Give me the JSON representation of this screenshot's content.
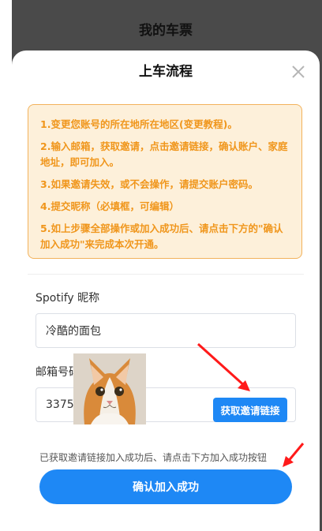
{
  "header": {
    "title": "我的车票"
  },
  "modal": {
    "title": "上车流程",
    "close_icon": "close-icon",
    "notice": {
      "lines": [
        "1.变更您账号的所在地所在地区(变更教程)。",
        "2.输入邮箱，获取邀请，点击邀请链接，确认账户、家庭地址，即可加入。",
        "3.如果邀请失效，或不会操作，请提交账户密码。",
        "4.提交昵称（必填框，可编辑）",
        "5.如上步骤全部操作或加入成功后、请点击下方的\"确认加入成功\"来完成本次开通。"
      ],
      "color": "#f0961c",
      "background": "#fdf0da",
      "border": "#f2b25b"
    },
    "nickname": {
      "label": "Spotify 昵称",
      "value": "冷酷的面包"
    },
    "email": {
      "label": "邮箱号码",
      "value": "33757"
    },
    "get_link_label": "获取邀请链接",
    "hint": "已获取邀请链接加入成功后、请点击下方加入成功按钮",
    "confirm_label": "确认加入成功",
    "accent": "#1e88f5",
    "arrow_color": "#ff1a1a"
  }
}
